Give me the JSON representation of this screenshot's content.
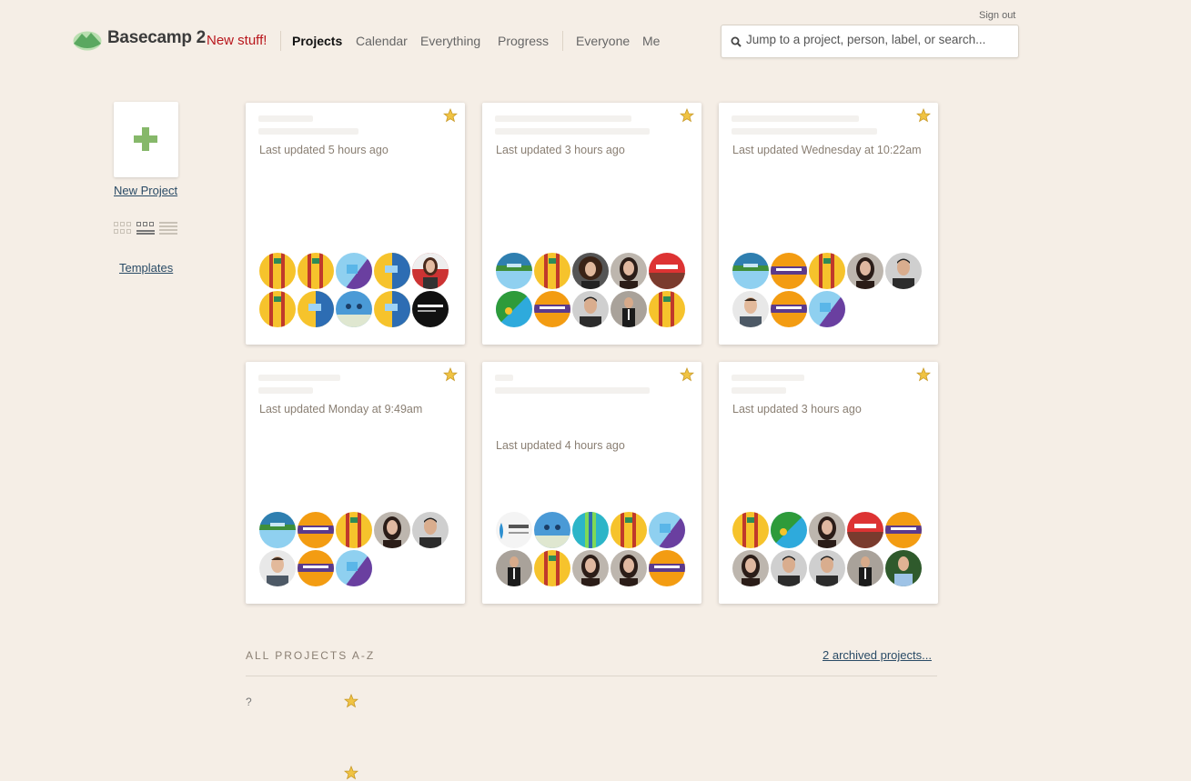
{
  "header": {
    "sign_out": "Sign out",
    "brand": "Basecamp 2",
    "new_stuff": "New stuff!",
    "nav": [
      "Projects",
      "Calendar",
      "Everything",
      "Progress",
      "Everyone",
      "Me"
    ],
    "search_placeholder": "Jump to a project, person, label, or search..."
  },
  "sidebar": {
    "new_project": "New Project",
    "templates": "Templates",
    "view_modes": [
      "grid-small-icon",
      "grid-card-icon",
      "list-icon"
    ]
  },
  "cards": [
    {
      "updated": "Last updated 5 hours ago",
      "starred": true,
      "avatars": [
        "yellow-red",
        "yellow-red",
        "blue-purple",
        "yellow-blue",
        "photo-woman-red",
        "yellow-red",
        "yellow-blue",
        "blue-robot",
        "yellow-blue",
        "black-logo"
      ]
    },
    {
      "updated": "Last updated 3 hours ago",
      "starred": true,
      "avatars": [
        "blue-landscape",
        "yellow-red",
        "photo-woman-curly",
        "photo-woman",
        "red-bus",
        "green-blue",
        "orange-purple",
        "photo-man",
        "photo-man-suit",
        "yellow-red"
      ]
    },
    {
      "updated": "Last updated Wednesday at 10:22am",
      "starred": true,
      "avatars": [
        "blue-landscape",
        "orange-purple",
        "yellow-red",
        "photo-woman",
        "photo-man",
        "photo-man-light",
        "orange-purple",
        "blue-purple"
      ]
    },
    {
      "updated": "Last updated Monday at 9:49am",
      "starred": true,
      "avatars": [
        "blue-landscape",
        "orange-purple",
        "yellow-red",
        "photo-woman",
        "photo-man",
        "photo-man-light",
        "orange-purple",
        "blue-purple"
      ]
    },
    {
      "updated": "Last updated 4 hours ago",
      "starred": true,
      "avatars": [
        "white-logo",
        "blue-robot",
        "teal-green",
        "yellow-red",
        "blue-purple",
        "photo-man-suit",
        "yellow-red",
        "photo-woman",
        "photo-woman",
        "orange-purple"
      ]
    },
    {
      "updated": "Last updated 3 hours ago",
      "starred": true,
      "avatars": [
        "yellow-red",
        "green-blue",
        "photo-woman",
        "red-bus",
        "orange-purple",
        "photo-woman",
        "photo-man",
        "photo-man",
        "photo-man-suit",
        "photo-man-green"
      ]
    }
  ],
  "all_projects": {
    "title": "ALL PROJECTS A-Z",
    "archived": "2 archived projects...",
    "first_letter": "?"
  },
  "colors": {
    "background": "#f5eee6",
    "accent_red": "#b8161c",
    "link": "#2a4b66",
    "star": "#f0c343",
    "plus_green": "#86b86a"
  }
}
